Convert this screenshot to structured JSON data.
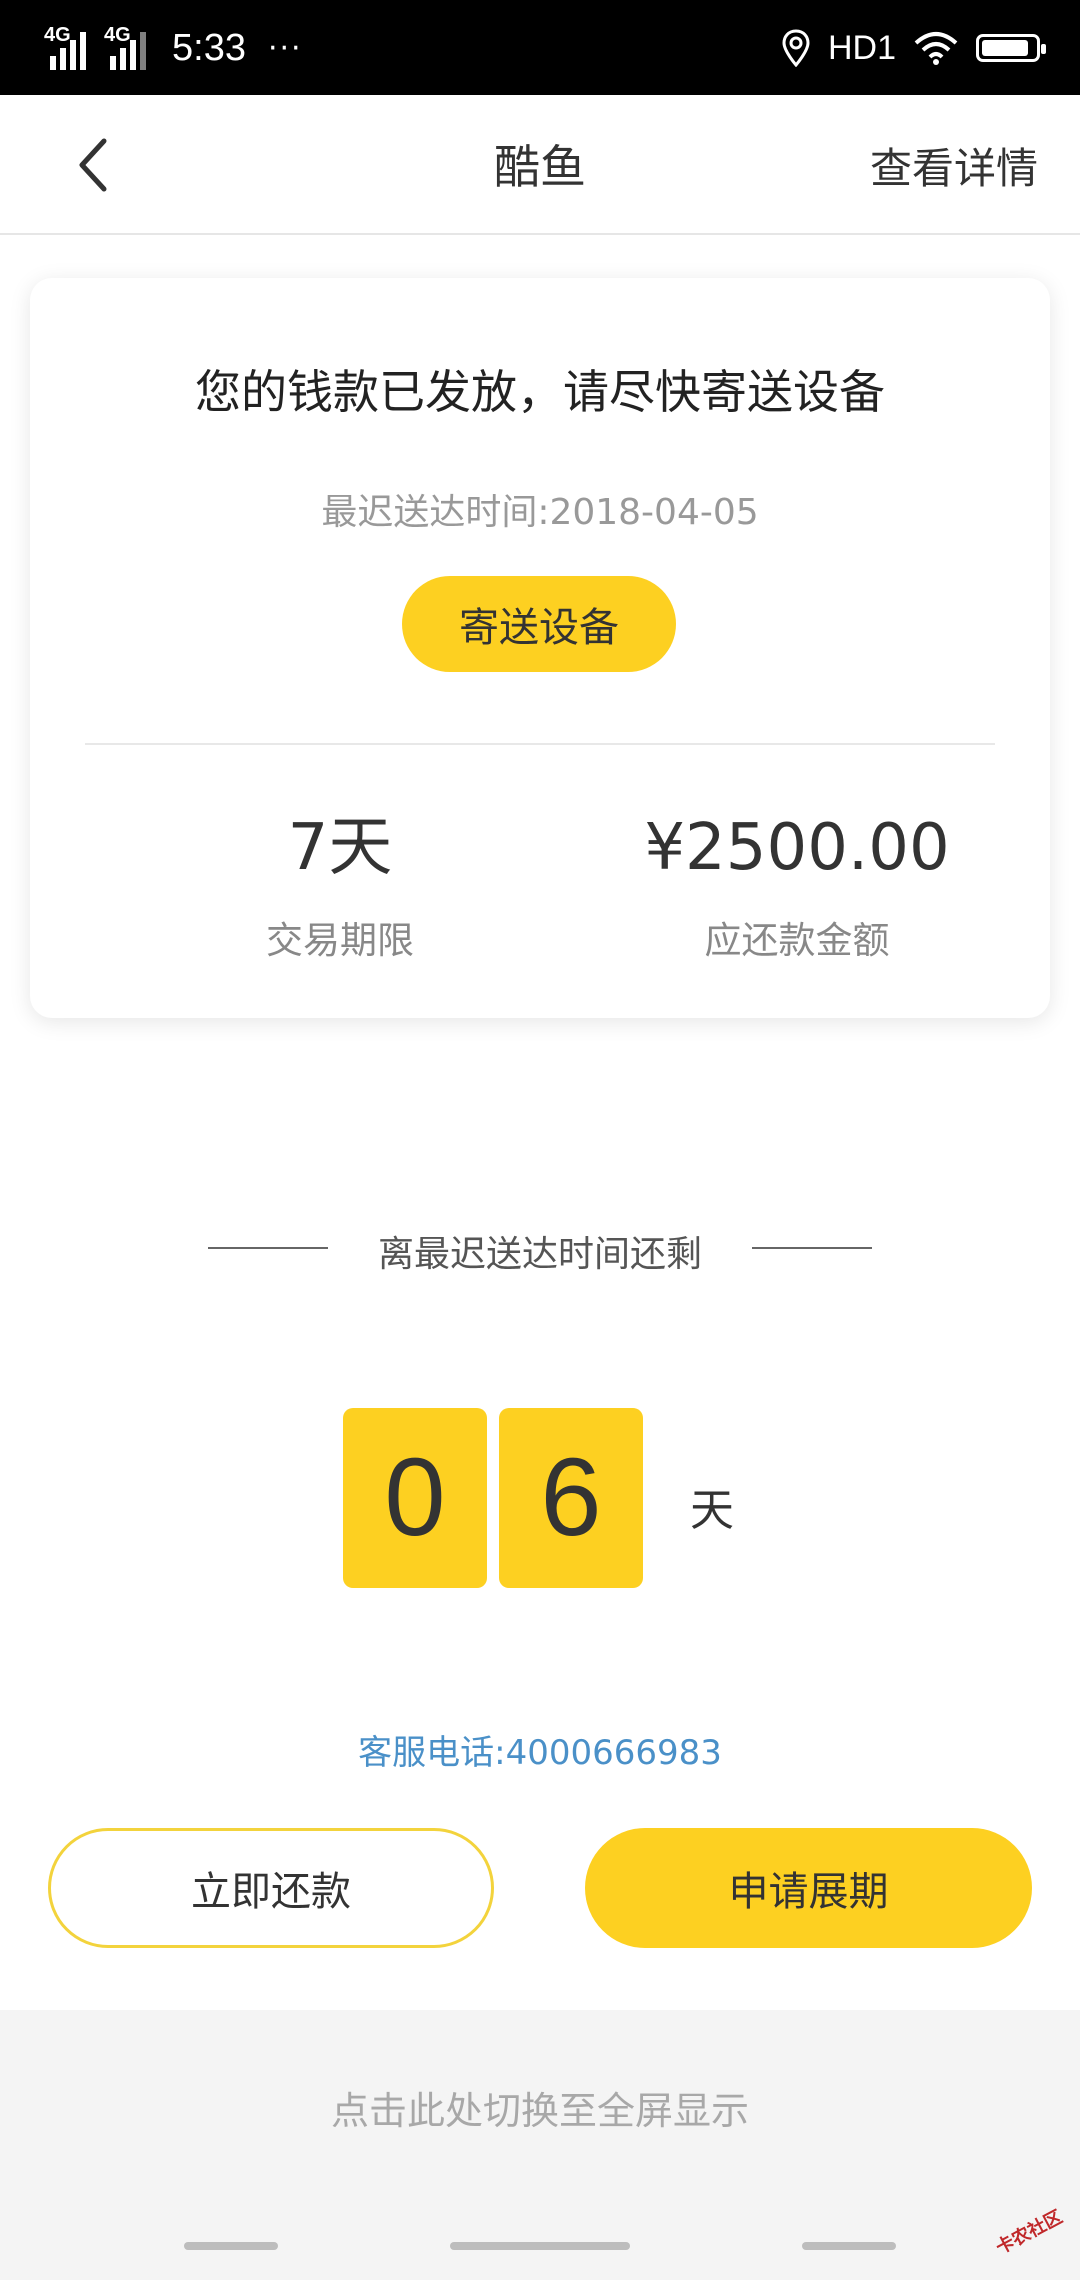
{
  "status_bar": {
    "network1": "4G",
    "network2": "4G",
    "time": "5:33",
    "more": "···",
    "hd": "HD1",
    "battery_level": 0.9
  },
  "nav": {
    "title": "酷鱼",
    "detail_link": "查看详情"
  },
  "card": {
    "headline": "您的钱款已发放，请尽快寄送设备",
    "deadline": "最迟送达时间:2018-04-05",
    "ship_button": "寄送设备",
    "term_value": "7天",
    "term_label": "交易期限",
    "amount_value": "¥2500.00",
    "amount_label": "应还款金额"
  },
  "countdown": {
    "title": "离最迟送达时间还剩",
    "digit1": "0",
    "digit2": "6",
    "unit": "天"
  },
  "service": {
    "phone_text": "客服电话:4000666983"
  },
  "actions": {
    "repay_label": "立即还款",
    "extend_label": "申请展期"
  },
  "bottom": {
    "fullscreen_hint": "点击此处切换至全屏显示",
    "watermark": "卡农社区"
  },
  "colors": {
    "accent_yellow": "#fdd021",
    "link_blue": "#4a90c8"
  }
}
